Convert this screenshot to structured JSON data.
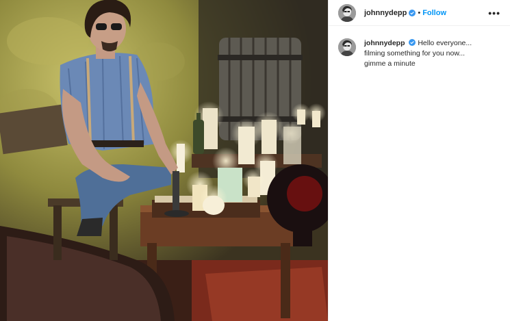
{
  "post": {
    "author": {
      "username": "johnnydepp",
      "verified": true,
      "avatar_icon": "profile-photo-icon",
      "verified_icon": "verified-badge-icon"
    },
    "header": {
      "separator": "•",
      "follow_label": "Follow",
      "more_icon": "more-options-icon",
      "more_label": "•••"
    },
    "caption": {
      "username": "johnnydepp",
      "text": "Hello everyone... filming something for you now... gimme a minute"
    },
    "colors": {
      "follow": "#0095f6",
      "verified": "#3897f0",
      "text": "#262626",
      "divider": "#efefef"
    }
  }
}
